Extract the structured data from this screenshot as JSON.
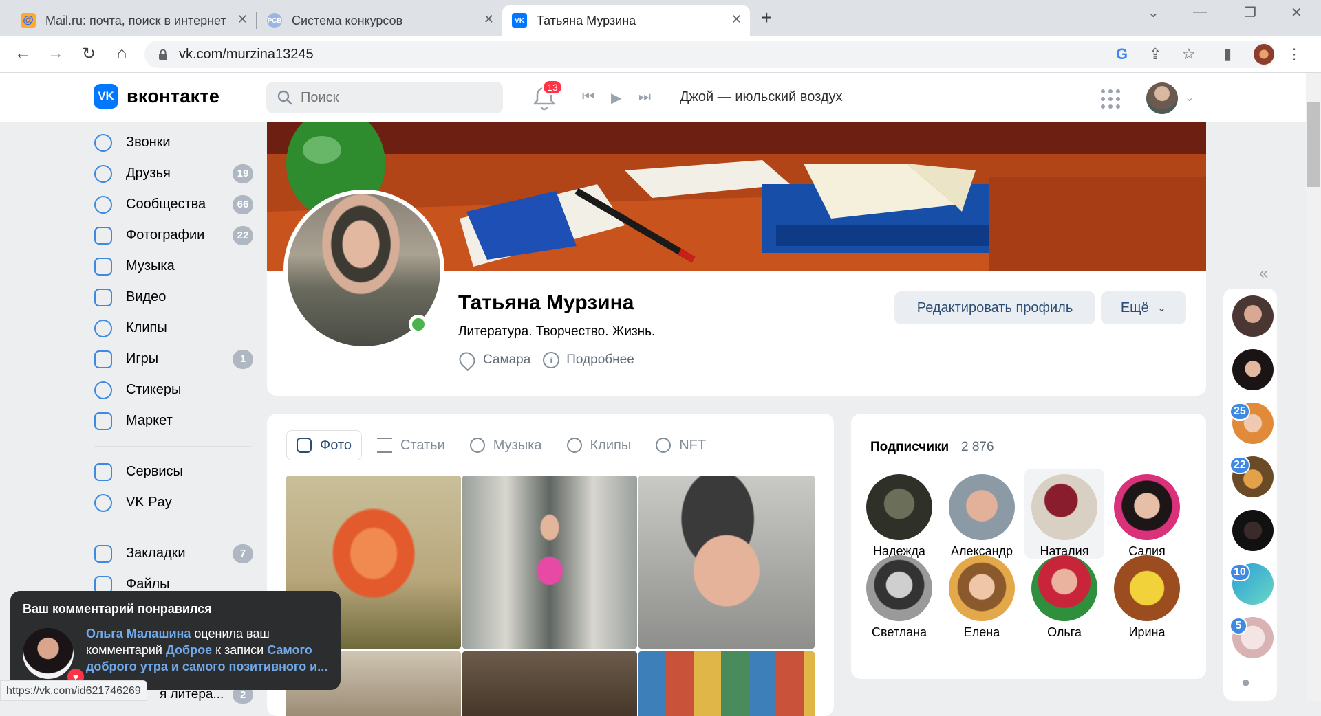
{
  "browser": {
    "tabs": [
      {
        "title": "Mail.ru: почта, поиск в интернете",
        "favicon": "mailru-icon",
        "color": "#2c6dff"
      },
      {
        "title": "Система конкурсов",
        "favicon": "rsv-icon",
        "color": "#5a8fd6"
      },
      {
        "title": "Татьяна Мурзина",
        "favicon": "vk-icon",
        "color": "#0077ff"
      }
    ],
    "url": "vk.com/murzina13245"
  },
  "header": {
    "logo_text": "вконтакте",
    "logo_mark": "VK",
    "search_placeholder": "Поиск",
    "notifications": "13",
    "track": "Джой — июльский воздух"
  },
  "nav": {
    "items": [
      {
        "label": "Звонки",
        "icon": "phone-icon"
      },
      {
        "label": "Друзья",
        "icon": "friends-icon",
        "count": "19"
      },
      {
        "label": "Сообщества",
        "icon": "communities-icon",
        "count": "66"
      },
      {
        "label": "Фотографии",
        "icon": "photos-icon",
        "count": "22"
      },
      {
        "label": "Музыка",
        "icon": "music-icon"
      },
      {
        "label": "Видео",
        "icon": "video-icon"
      },
      {
        "label": "Клипы",
        "icon": "clips-icon"
      },
      {
        "label": "Игры",
        "icon": "games-icon",
        "count": "1"
      },
      {
        "label": "Стикеры",
        "icon": "stickers-icon"
      },
      {
        "label": "Маркет",
        "icon": "market-icon"
      }
    ],
    "items2": [
      {
        "label": "Сервисы",
        "icon": "services-icon"
      },
      {
        "label": "VK Pay",
        "icon": "vkpay-icon"
      }
    ],
    "items3": [
      {
        "label": "Закладки",
        "icon": "bookmarks-icon",
        "count": "7"
      },
      {
        "label": "Файлы",
        "icon": "files-icon"
      }
    ],
    "hidden_item": {
      "label": "я литера...",
      "count": "2"
    }
  },
  "profile": {
    "name": "Татьяна Мурзина",
    "status": "Литература. Творчество. Жизнь.",
    "city": "Самара",
    "more_info": "Подробнее",
    "edit_button": "Редактировать профиль",
    "more_button": "Ещё"
  },
  "media": {
    "tabs": [
      "Фото",
      "Статьи",
      "Музыка",
      "Клипы",
      "NFT"
    ]
  },
  "subscribers": {
    "title": "Подписчики",
    "count": "2 876",
    "people": [
      "Надежда",
      "Александр",
      "Наталия",
      "Салия",
      "Светлана",
      "Елена",
      "Ольга",
      "Ирина"
    ]
  },
  "rail": {
    "badges": [
      "25",
      "22",
      "10",
      "5"
    ]
  },
  "toast": {
    "title": "Ваш комментарий понравился",
    "author": "Ольга Малашина",
    "t1": " оценила ваш комментарий ",
    "comment": "Доброе",
    "t2": " к записи ",
    "post": "Самого доброго утра и самого позитивного и..."
  },
  "statusbar": {
    "url": "https://vk.com/id621746269"
  }
}
